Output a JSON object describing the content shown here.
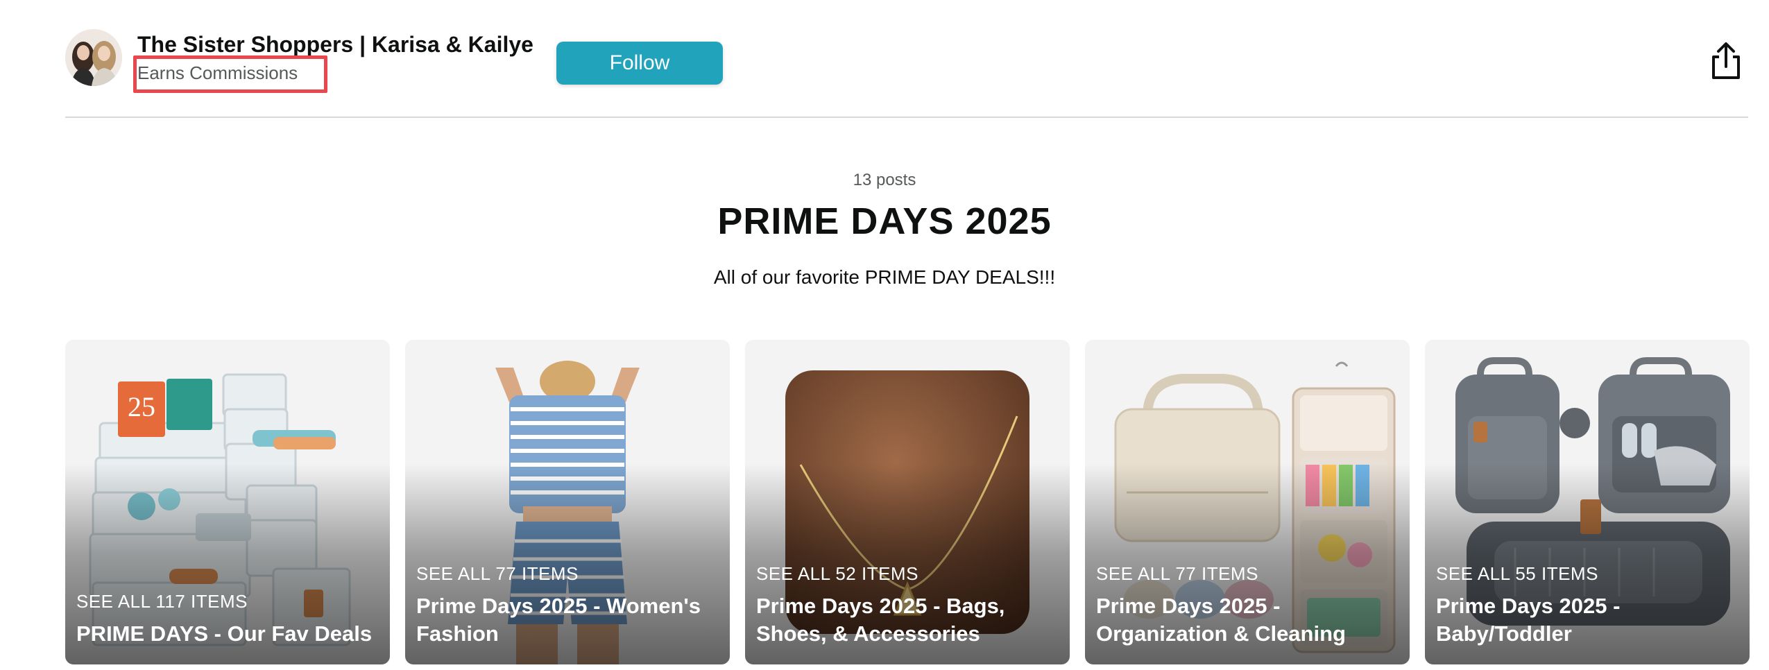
{
  "header": {
    "creator_name": "The Sister Shoppers | Karisa & Kailye",
    "badge": "Earns Commissions",
    "follow_label": "Follow"
  },
  "list": {
    "post_count": "13 posts",
    "title": "PRIME DAYS 2025",
    "description": "All of our favorite PRIME DAY DEALS!!!"
  },
  "cards": [
    {
      "see_all": "SEE ALL 117 ITEMS",
      "title": "PRIME DAYS - Our Fav Deals"
    },
    {
      "see_all": "SEE ALL 77 ITEMS",
      "title": "Prime Days 2025 - Women's Fashion"
    },
    {
      "see_all": "SEE ALL 52 ITEMS",
      "title": "Prime Days 2025 - Bags, Shoes, & Accessories"
    },
    {
      "see_all": "SEE ALL 77 ITEMS",
      "title": "Prime Days 2025 - Organization & Cleaning"
    },
    {
      "see_all": "SEE ALL 55 ITEMS",
      "title": "Prime Days 2025 - Baby/Toddler"
    }
  ],
  "icons": {
    "share": "share-icon",
    "avatar": "avatar-image"
  },
  "colors": {
    "follow_button": "#20a3bb",
    "highlight_box": "#e8474e"
  }
}
